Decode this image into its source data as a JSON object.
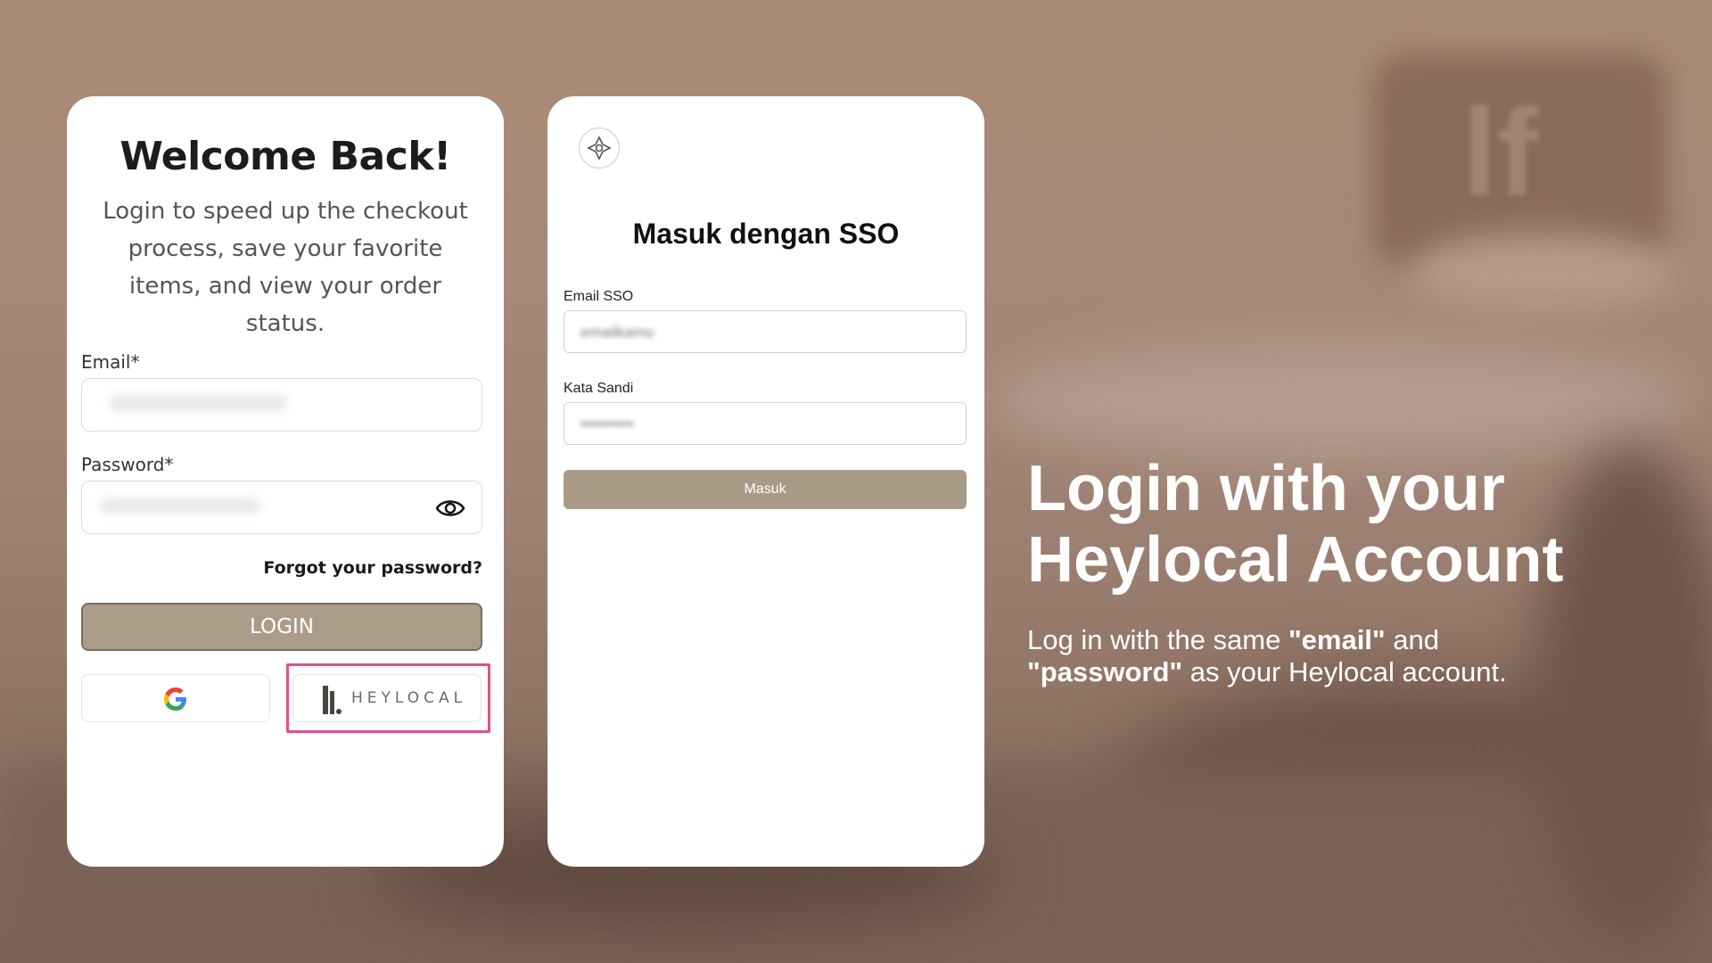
{
  "login_card": {
    "title": "Welcome Back!",
    "subtitle": "Login to speed up the checkout process, save your favorite items, and view your order status.",
    "email_label": "Email*",
    "password_label": "Password*",
    "forgot_password": "Forgot your password?",
    "login_button": "LOGIN",
    "google_icon": "google-g-icon",
    "heylocal_button_text": "HEYLOCAL"
  },
  "sso_card": {
    "logo_icon": "sso-shield-icon",
    "title": "Masuk dengan SSO",
    "email_label": "Email SSO",
    "email_value": "emailkamu",
    "password_label": "Kata Sandi",
    "password_value": "••••••••••",
    "submit_button": "Masuk"
  },
  "side_text": {
    "headline_line1": "Login with your",
    "headline_line2": "Heylocal Account",
    "desc_prefix": "Log in with the same ",
    "desc_email": "\"email\"",
    "desc_and": " and ",
    "desc_password": "\"password\"",
    "desc_suffix": " as your Heylocal account."
  },
  "colors": {
    "highlight": "#e0508a",
    "login_button": "#ab9c8a",
    "masuk_button": "#a99a88"
  }
}
